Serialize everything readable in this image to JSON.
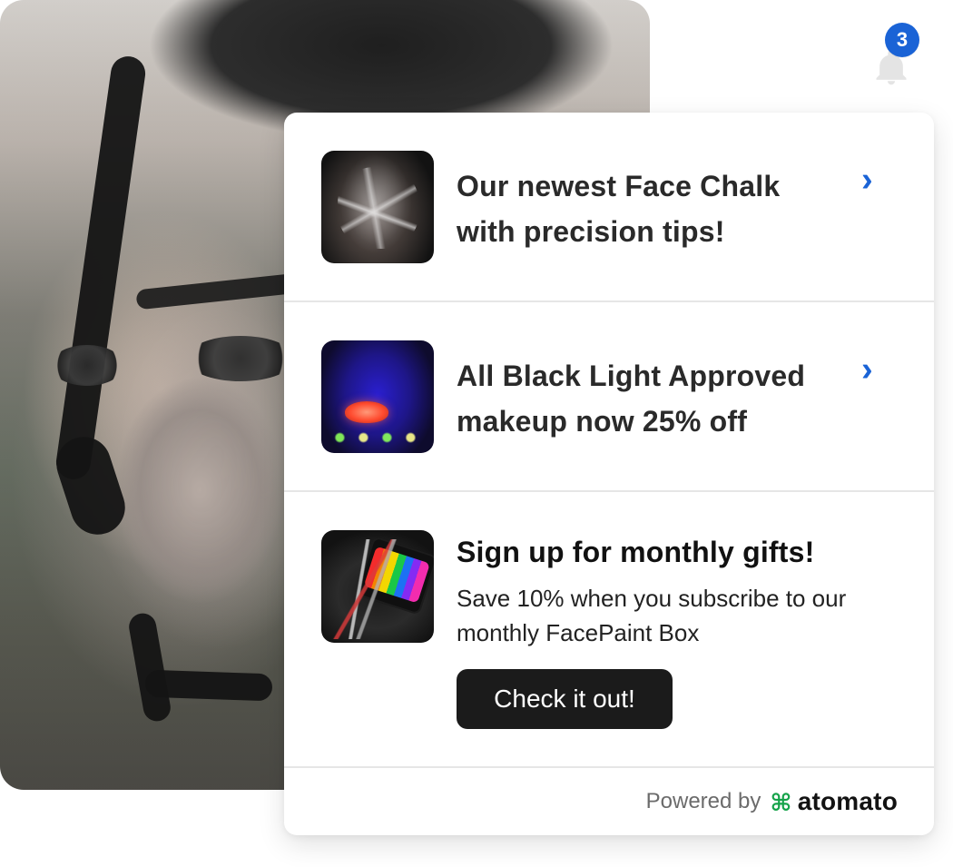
{
  "notifications": {
    "count": "3",
    "icon": "bell-icon",
    "badge_color": "#1a63d6"
  },
  "items": [
    {
      "title": "Our newest Face Chalk with precision tips!",
      "chevron": "›",
      "thumbnail_icon": "face-chalk-image"
    },
    {
      "title": "All Black Light Approved makeup now 25% off",
      "chevron": "›",
      "thumbnail_icon": "black-light-makeup-image"
    }
  ],
  "signup": {
    "title": "Sign up for monthly gifts!",
    "description": "Save 10% when you subscribe to our monthly FacePaint Box",
    "cta_label": "Check it out!",
    "thumbnail_icon": "facepaint-box-image"
  },
  "footer": {
    "powered_by": "Powered by",
    "brand_name": "atomato",
    "brand_icon": "command-icon",
    "brand_icon_glyph": "⌘",
    "brand_icon_color": "#16a34a"
  }
}
